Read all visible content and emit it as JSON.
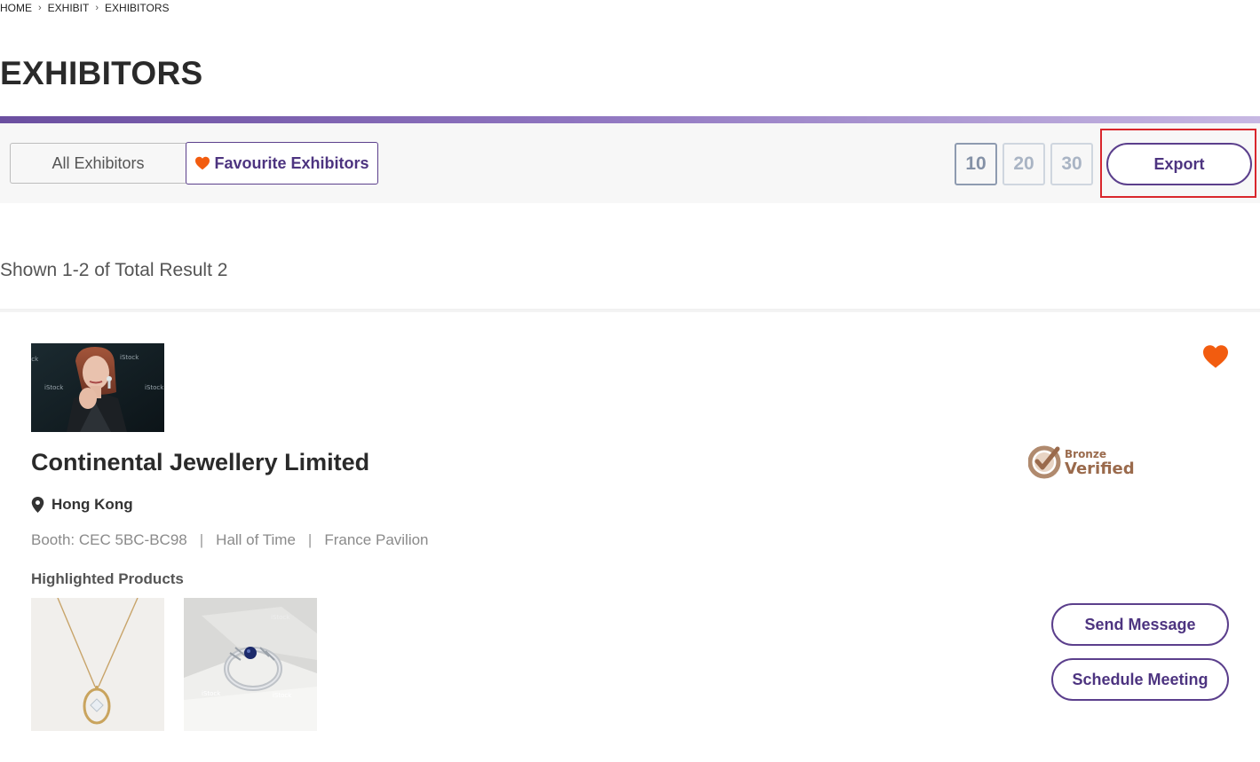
{
  "breadcrumb": {
    "items": [
      "HOME",
      "EXHIBIT",
      "EXHIBITORS"
    ]
  },
  "page": {
    "title": "EXHIBITORS"
  },
  "tabs": {
    "all_label": "All Exhibitors",
    "favourite_label": "Favourite Exhibitors",
    "active": "favourite"
  },
  "page_size": {
    "options": [
      "10",
      "20",
      "30"
    ],
    "selected": "10"
  },
  "toolbar": {
    "export_label": "Export"
  },
  "results": {
    "summary": "Shown 1-2 of Total Result 2"
  },
  "exhibitor": {
    "name": "Continental Jewellery Limited",
    "location": "Hong Kong",
    "booth": "Booth: CEC 5BC-BC98",
    "hall": "Hall of Time",
    "pavilion": "France Pavilion",
    "badge": {
      "line1": "Bronze",
      "line2": "Verified"
    },
    "highlighted_title": "Highlighted Products",
    "products": [
      "necklace-pendant-image",
      "sapphire-ring-image"
    ],
    "favourited": true
  },
  "actions": {
    "send_message": "Send Message",
    "schedule_meeting": "Schedule Meeting"
  },
  "colors": {
    "brand": "#5b3f8c",
    "heart": "#f25c0f",
    "badge": "#9a6a4c",
    "export_highlight": "#d9262c"
  }
}
